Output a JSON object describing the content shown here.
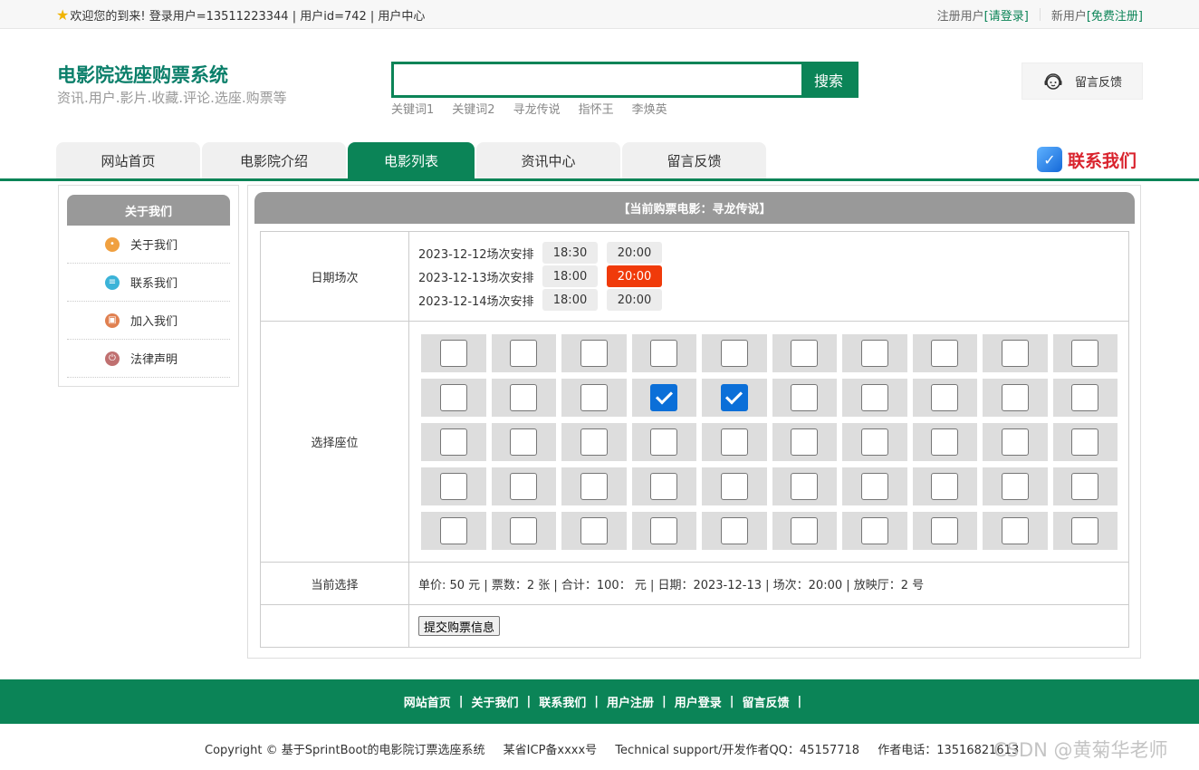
{
  "topbar": {
    "welcome": "欢迎您的到来!  登录用户=13511223344 | 用户id=742 | 用户中心",
    "register_label": "注册用户",
    "login_link": "[请登录]",
    "new_user_label": "新用户",
    "free_register_link": "[免费注册]"
  },
  "header": {
    "site_title": "电影院选座购票系统",
    "site_subtitle": "资讯.用户.影片.收藏.评论.选座.购票等",
    "search_value": "",
    "search_button": "搜索",
    "hot_words": [
      "关键词1",
      "关键词2",
      "寻龙传说",
      "指怀王",
      "李焕英"
    ],
    "feedback": "留言反馈"
  },
  "nav": {
    "tabs": [
      "网站首页",
      "电影院介绍",
      "电影列表",
      "资讯中心",
      "留言反馈"
    ],
    "active_tab": 2,
    "contact_us": "联系我们"
  },
  "sidebar": {
    "title": "关于我们",
    "items": [
      {
        "label": "关于我们",
        "icon": "orange-circle-icon",
        "color": "#f0a040"
      },
      {
        "label": "联系我们",
        "icon": "clipboard-icon",
        "color": "#3bb3d8"
      },
      {
        "label": "加入我们",
        "icon": "lock-icon",
        "color": "#e08050"
      },
      {
        "label": "法律声明",
        "icon": "power-icon",
        "color": "#c07070"
      }
    ]
  },
  "main": {
    "title": "【当前购票电影：寻龙传说】",
    "date_label": "日期场次",
    "schedules": [
      {
        "label": "2023-12-12场次安排",
        "times": [
          "18:30",
          "20:00"
        ],
        "selected": -1
      },
      {
        "label": "2023-12-13场次安排",
        "times": [
          "18:00",
          "20:00"
        ],
        "selected": 1
      },
      {
        "label": "2023-12-14场次安排",
        "times": [
          "18:00",
          "20:00"
        ],
        "selected": -1
      }
    ],
    "seat_label": "选择座位",
    "seat_rows": 5,
    "seat_cols": 10,
    "checked_seats": [
      [
        2,
        4
      ],
      [
        2,
        5
      ]
    ],
    "current_label": "当前选择",
    "current_text": "单价: 50 元 | 票数：2 张 | 合计：100：  元 | 日期：2023-12-13 | 场次：20:00 | 放映厅：2 号",
    "submit_label": "提交购票信息"
  },
  "footer": {
    "links": [
      "网站首页",
      "关于我们",
      "联系我们",
      "用户注册",
      "用户登录",
      "留言反馈"
    ],
    "copyright": "Copyright © 基于SprintBoot的电影院订票选座系统",
    "icp": "某省ICP备xxxx号",
    "support": "Technical support/开发作者QQ：45157718",
    "phone": "作者电话：13516821613",
    "watermark": "CSDN @黄菊华老师"
  },
  "colors": {
    "brand_green": "#0b8457",
    "selected_slot": "#f03a0a",
    "contact_red": "#d9232d"
  }
}
